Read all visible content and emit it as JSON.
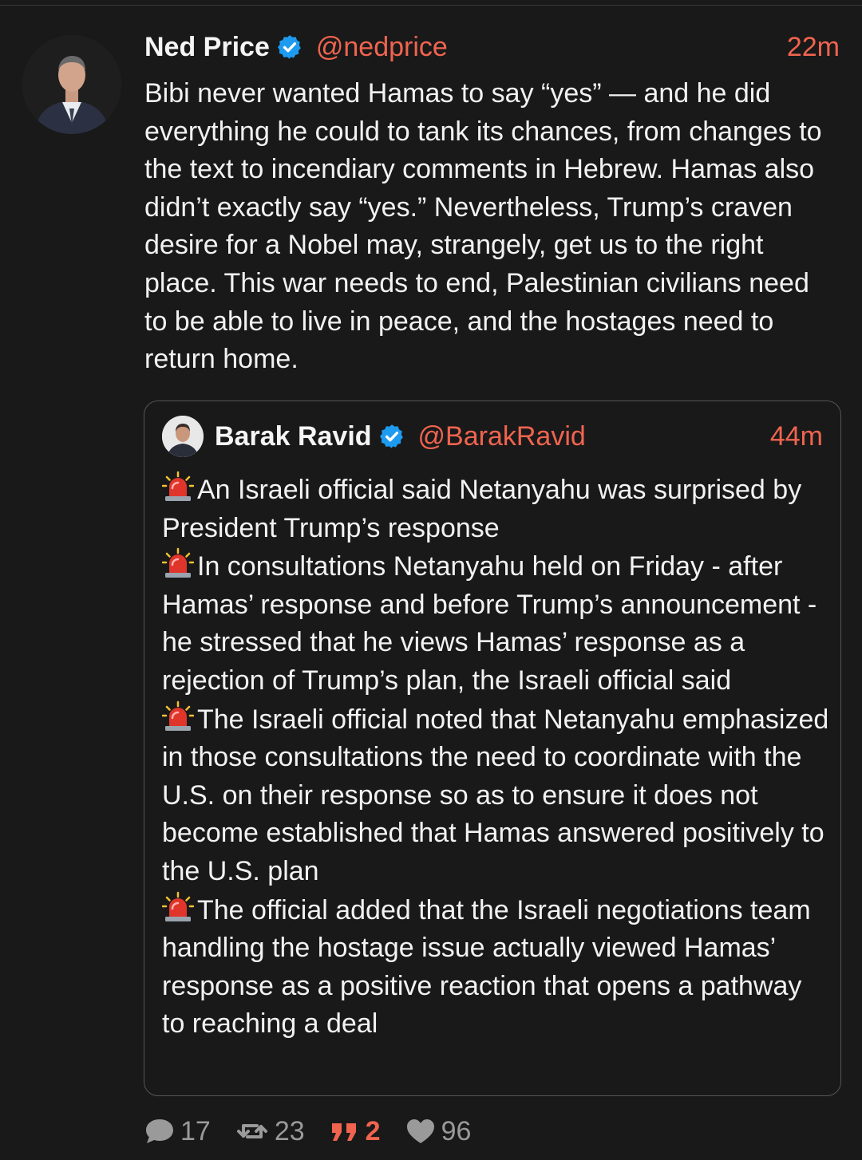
{
  "post": {
    "author_name": "Ned Price",
    "author_handle": "@nedprice",
    "time": "22m",
    "verified": true,
    "text": "Bibi never wanted Hamas to say “yes” — and he did everything he could to tank its chances, from changes to the text to incendiary comments in Hebrew. Hamas also didn’t exactly say “yes.” Nevertheless, Trump’s craven desire for a Nobel may, strangely, get us to the right place. This war needs to end, Palestinian civilians need to be able to live in peace, and the hostages need to return home."
  },
  "quoted_post": {
    "author_name": "Barak Ravid",
    "author_handle": "@BarakRavid",
    "time": "44m",
    "verified": true,
    "lines": [
      "An Israeli official said Netanyahu was surprised by President Trump’s response",
      "In consultations Netanyahu held on Friday - after Hamas’ response and before Trump’s announcement - he stressed that he views Hamas’ response as a rejection of Trump’s plan, the Israeli official said",
      "The Israeli official noted that Netanyahu emphasized in those consultations the need to coordinate with the U.S. on their response so as to ensure it does not become established that Hamas answered positively to the U.S. plan",
      "The official added that the Israeli negotiations team handling the hostage issue actually viewed Hamas’ response as a positive reaction that opens a pathway to reaching a deal"
    ],
    "line_icon": "police-light-emoji-icon"
  },
  "actions": {
    "replies": "17",
    "reposts": "23",
    "quotes": "2",
    "likes": "96"
  },
  "colors": {
    "background": "#191919",
    "accent": "#f0644f",
    "verified": "#1d9bf0",
    "muted": "#9a9a9a"
  }
}
